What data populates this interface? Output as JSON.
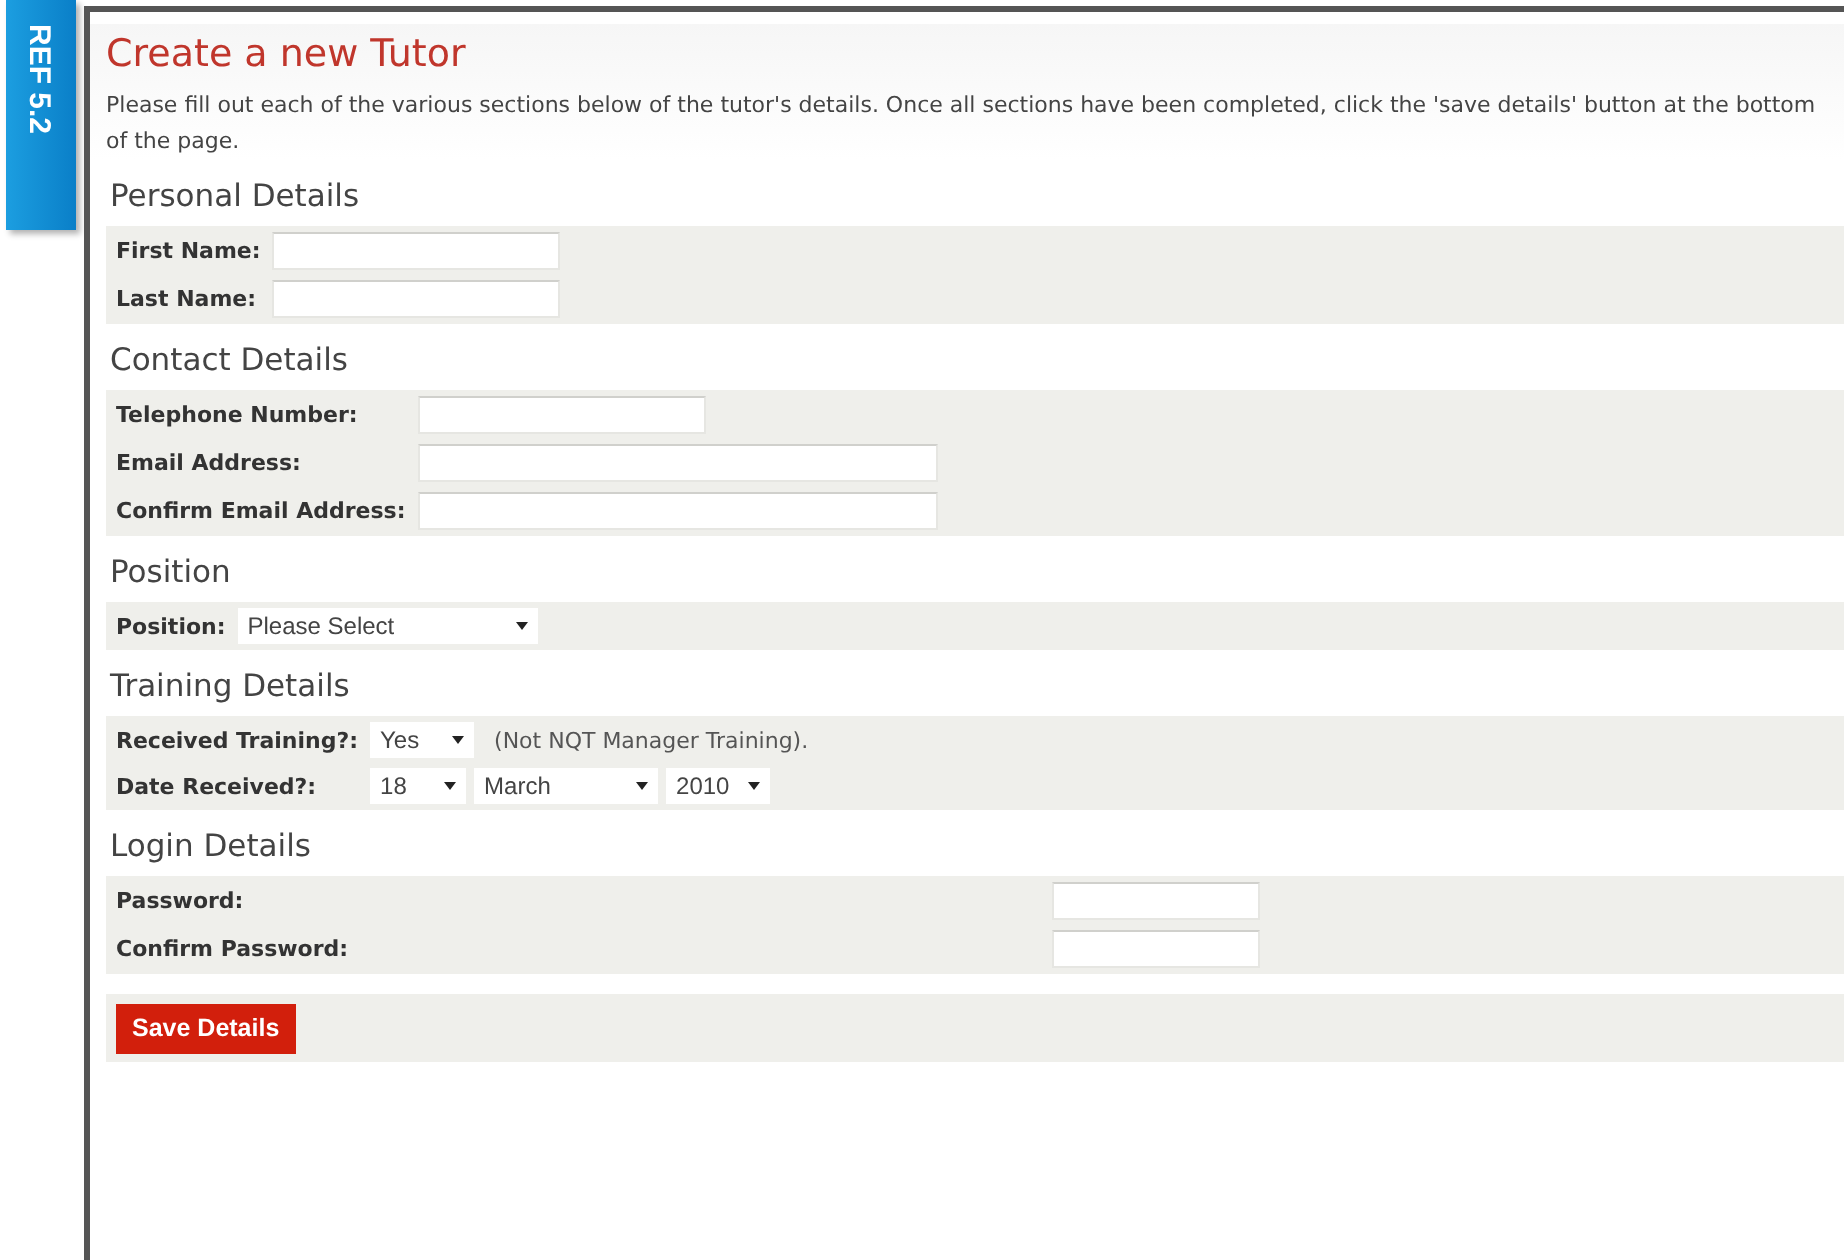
{
  "tag": "REF 5.2",
  "title": "Create a new Tutor",
  "intro": "Please fill out each of the various sections below of the tutor's details. Once all sections have been completed, click the 'save details' button at the bottom of the page.",
  "sections": [
    {
      "heading": "Personal Details",
      "rows": [
        {
          "kind": "text",
          "label": "First Name:"
        },
        {
          "kind": "text",
          "label": "Last Name:"
        }
      ]
    },
    {
      "heading": "Contact Details",
      "rows": [
        {
          "kind": "text",
          "label": "Telephone Number:"
        },
        {
          "kind": "text",
          "label": "Email Address:"
        },
        {
          "kind": "text",
          "label": "Confirm Email Address:"
        }
      ]
    },
    {
      "heading": "Position",
      "rows": [
        {
          "kind": "select",
          "label": "Position:",
          "selects": [
            {
              "value": "Please Select"
            }
          ]
        }
      ]
    },
    {
      "heading": "Training Details",
      "rows": [
        {
          "kind": "select",
          "label": "Received Training?:",
          "selects": [
            {
              "value": "Yes"
            }
          ],
          "note": "(Not NQT Manager Training)."
        },
        {
          "kind": "select",
          "label": "Date Received?:",
          "selects": [
            {
              "value": "18"
            },
            {
              "value": "March"
            },
            {
              "value": "2010"
            }
          ]
        }
      ]
    },
    {
      "heading": "Login Details",
      "rows": [
        {
          "kind": "password",
          "label": "Password:"
        },
        {
          "kind": "password",
          "label": "Confirm Password:"
        }
      ]
    }
  ],
  "save_button": "Save Details"
}
